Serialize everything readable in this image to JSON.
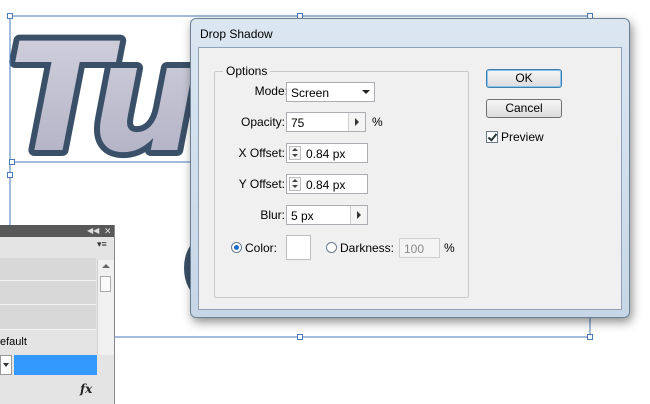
{
  "artwork": {
    "text": "Tut"
  },
  "dialog": {
    "title": "Drop Shadow",
    "options_legend": "Options",
    "mode": {
      "label": "Mode:",
      "value": "Screen"
    },
    "opacity": {
      "label": "Opacity:",
      "value": "75",
      "unit": "%"
    },
    "x_offset": {
      "label": "X Offset:",
      "value": "0.84 px"
    },
    "y_offset": {
      "label": "Y Offset:",
      "value": "0.84 px"
    },
    "blur": {
      "label": "Blur:",
      "value": "5 px"
    },
    "color": {
      "label": "Color:",
      "selected": true,
      "swatch": "#ffffff"
    },
    "darkness": {
      "label": "Darkness:",
      "value": "100",
      "unit": "%",
      "selected": false
    },
    "ok_label": "OK",
    "cancel_label": "Cancel",
    "preview": {
      "label": "Preview",
      "checked": true
    }
  },
  "panel": {
    "text": "efault",
    "fx_label": "fx"
  },
  "colors": {
    "artwork_outline": "#3a5068",
    "artwork_fill": "#c3c3d3",
    "selection": "#4a7ab8",
    "highlight": "#3399ff"
  }
}
